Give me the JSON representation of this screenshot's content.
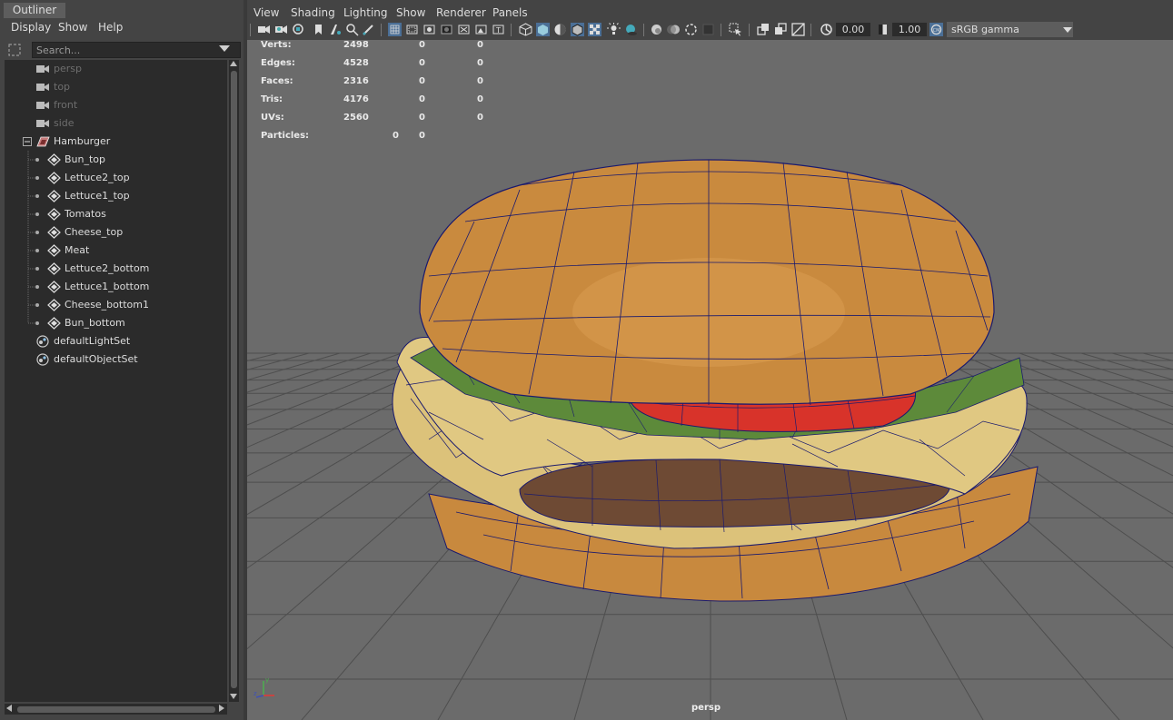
{
  "outliner": {
    "tab_title": "Outliner",
    "menu": [
      "Display",
      "Show",
      "Help"
    ],
    "search_placeholder": "Search...",
    "items": [
      {
        "label": "persp",
        "kind": "camera"
      },
      {
        "label": "top",
        "kind": "camera"
      },
      {
        "label": "front",
        "kind": "camera"
      },
      {
        "label": "side",
        "kind": "camera"
      },
      {
        "label": "Hamburger",
        "kind": "group"
      },
      {
        "label": "Bun_top",
        "kind": "mesh"
      },
      {
        "label": "Lettuce2_top",
        "kind": "mesh"
      },
      {
        "label": "Lettuce1_top",
        "kind": "mesh"
      },
      {
        "label": "Tomatos",
        "kind": "mesh"
      },
      {
        "label": "Cheese_top",
        "kind": "mesh"
      },
      {
        "label": "Meat",
        "kind": "mesh"
      },
      {
        "label": "Lettuce2_bottom",
        "kind": "mesh"
      },
      {
        "label": "Lettuce1_bottom",
        "kind": "mesh"
      },
      {
        "label": "Cheese_bottom1",
        "kind": "mesh"
      },
      {
        "label": "Bun_bottom",
        "kind": "mesh"
      },
      {
        "label": "defaultLightSet",
        "kind": "set"
      },
      {
        "label": "defaultObjectSet",
        "kind": "set"
      }
    ]
  },
  "viewport": {
    "menu": [
      "View",
      "Shading",
      "Lighting",
      "Show",
      "Renderer",
      "Panels"
    ],
    "toolbar": {
      "exposure": "0.00",
      "gamma": "1.00",
      "color_space": "sRGB gamma"
    },
    "hud": [
      {
        "label": "Verts:",
        "values": [
          "2498",
          "0",
          "0"
        ]
      },
      {
        "label": "Edges:",
        "values": [
          "4528",
          "0",
          "0"
        ]
      },
      {
        "label": "Faces:",
        "values": [
          "2316",
          "0",
          "0"
        ]
      },
      {
        "label": "Tris:",
        "values": [
          "4176",
          "0",
          "0"
        ]
      },
      {
        "label": "UVs:",
        "values": [
          "2560",
          "0",
          "0"
        ]
      },
      {
        "label": "Particles:",
        "values": [
          "0",
          "0"
        ]
      }
    ],
    "camera_label": "persp",
    "colors": {
      "background": "#6b6b6b",
      "grid": "#4e4e4e",
      "wire": "#1a1a6e",
      "bun": "#c98a3e",
      "cheese": "#dcc27a",
      "lettuce": "#5d8a3a",
      "tomato": "#d8332a",
      "meat": "#6e4a34"
    }
  }
}
